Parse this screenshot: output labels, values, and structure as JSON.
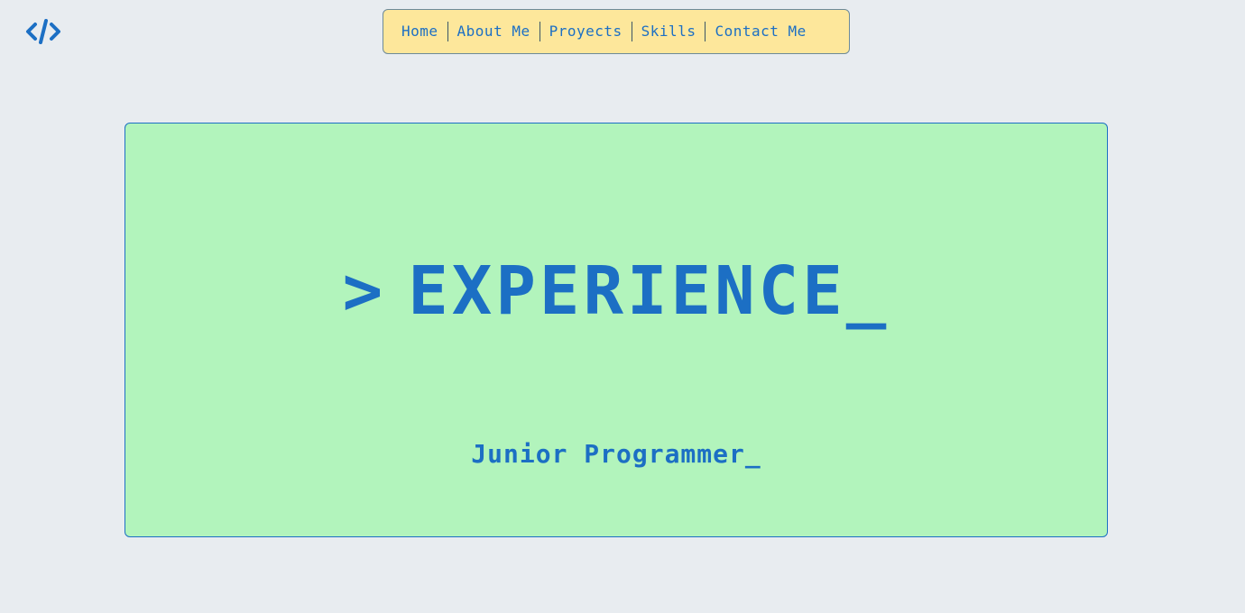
{
  "logo": {
    "icon": "code-brackets-icon"
  },
  "nav": {
    "items": [
      {
        "label": "Home"
      },
      {
        "label": "About Me"
      },
      {
        "label": "Proyects"
      },
      {
        "label": "Skills"
      },
      {
        "label": "Contact Me"
      }
    ]
  },
  "hero": {
    "prompt": ">",
    "title": "EXPERIENCE_",
    "subtitle": "Junior Programmer_"
  },
  "colors": {
    "background": "#e8ecf0",
    "accent": "#1c6fc4",
    "nav_bg": "#fde79b",
    "hero_bg": "#b2f4bc"
  }
}
